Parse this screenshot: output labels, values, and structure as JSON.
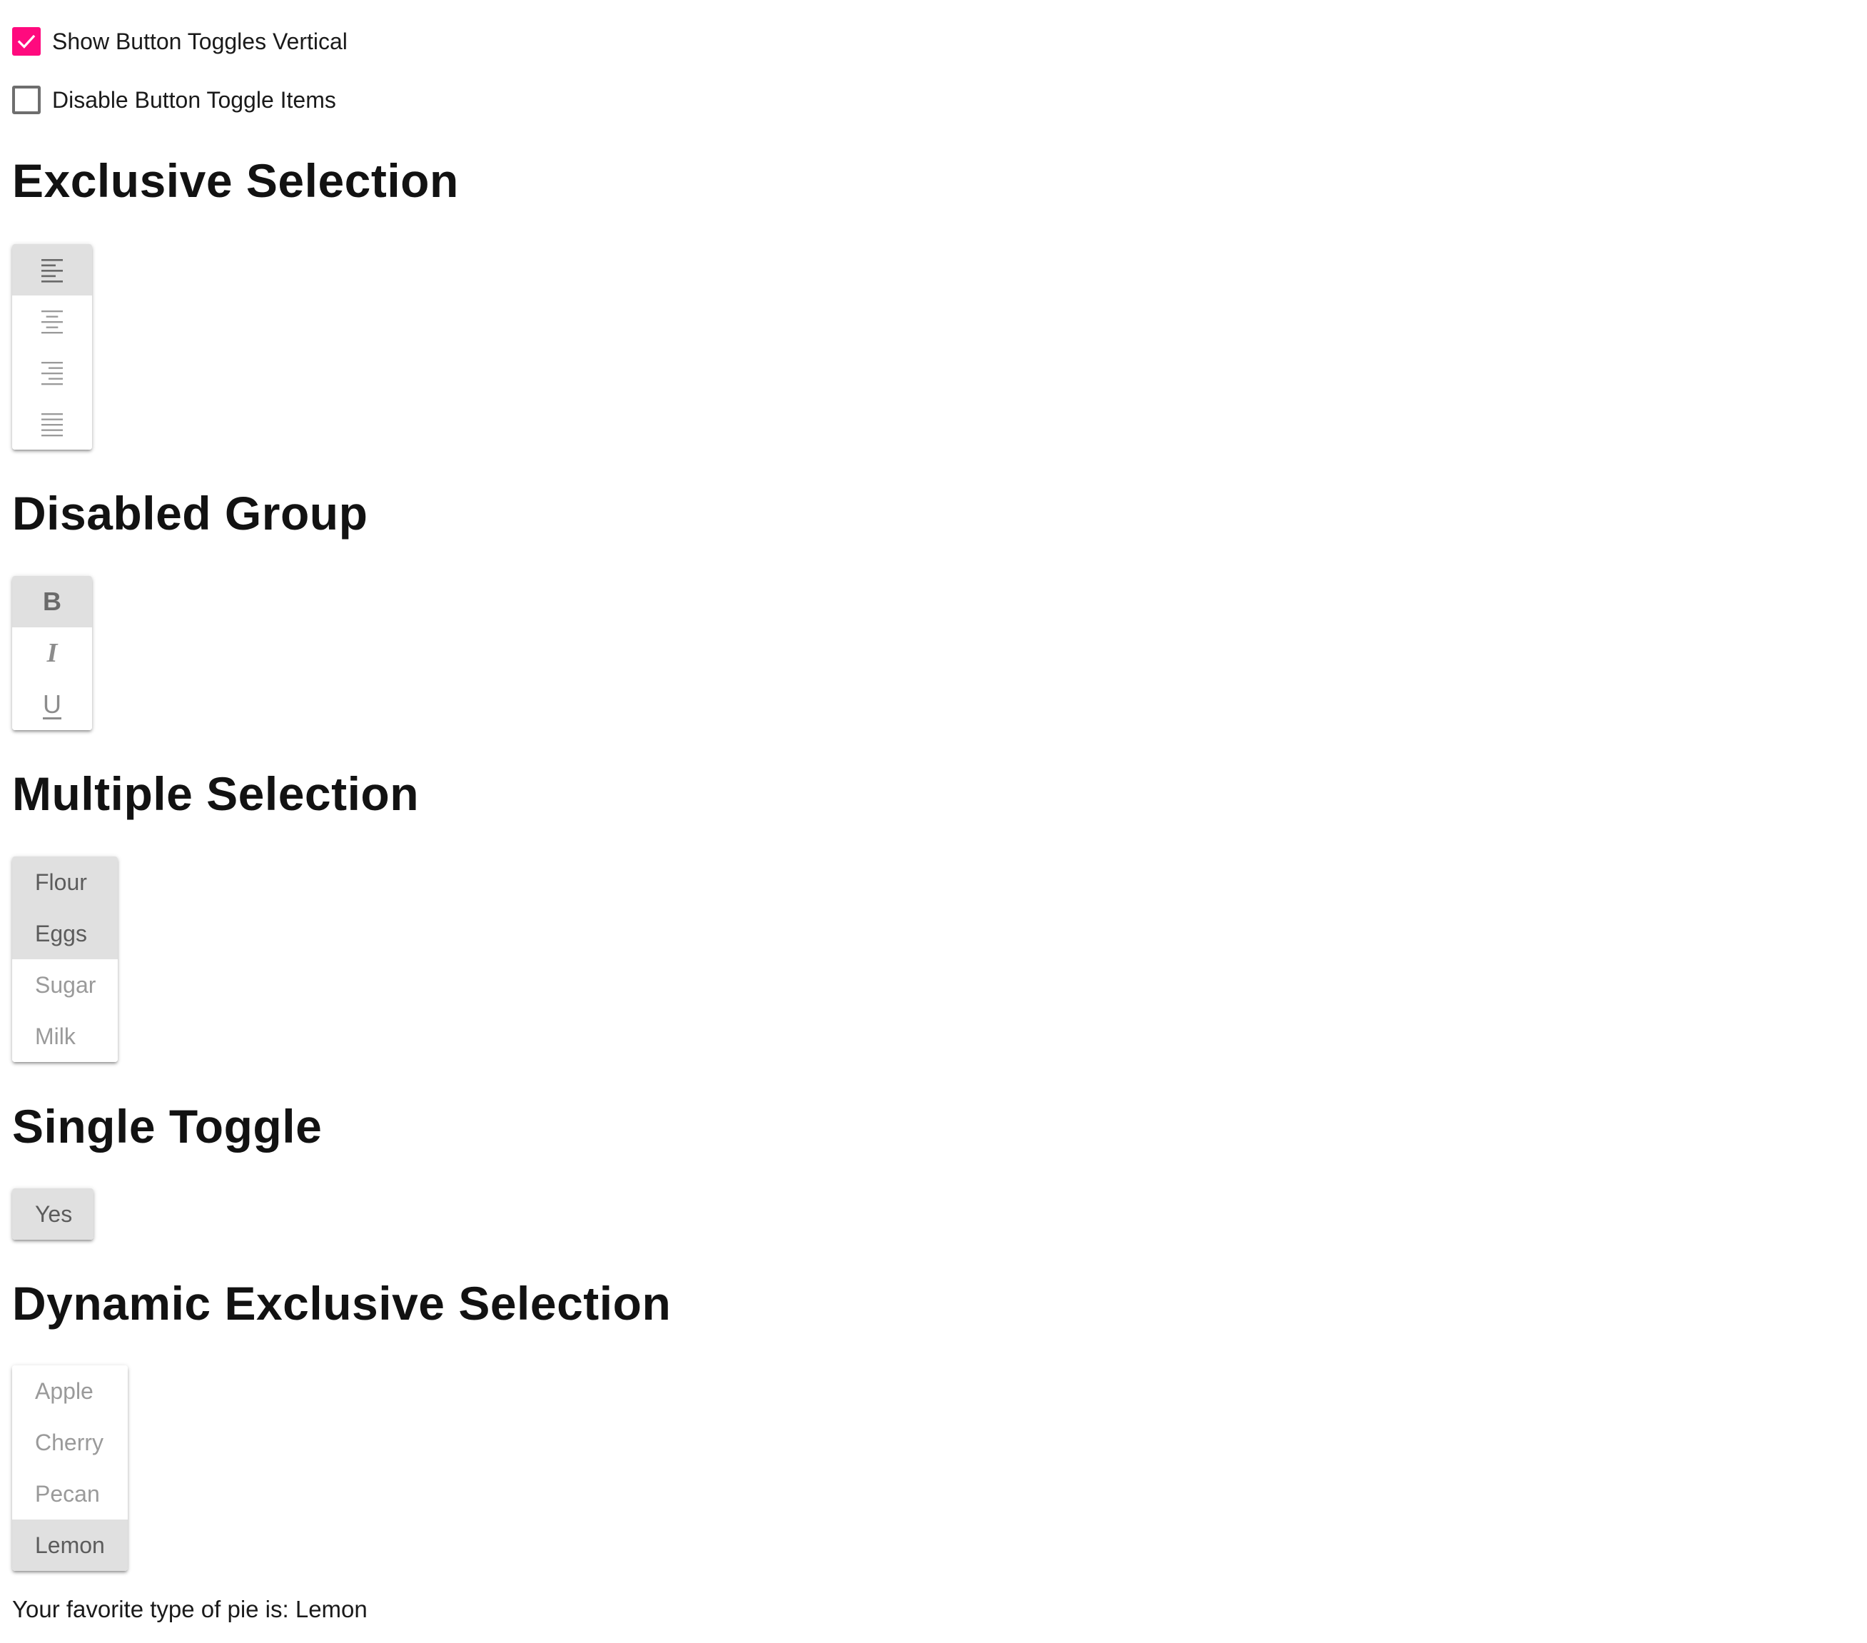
{
  "options": {
    "vertical": {
      "label": "Show Button Toggles Vertical",
      "checked": true
    },
    "disable_items": {
      "label": "Disable Button Toggle Items",
      "checked": false
    }
  },
  "colors": {
    "accent": "#ff0a7e",
    "selected_bg": "#e0e0e0"
  },
  "sections": {
    "exclusive": {
      "title": "Exclusive Selection",
      "items": [
        {
          "icon": "format-align-left-icon",
          "selected": true
        },
        {
          "icon": "format-align-center-icon",
          "selected": false
        },
        {
          "icon": "format-align-right-icon",
          "selected": false
        },
        {
          "icon": "format-align-justify-icon",
          "selected": false
        }
      ]
    },
    "disabled": {
      "title": "Disabled Group",
      "items": [
        {
          "glyph": "B",
          "icon": "format-bold-icon",
          "selected": true
        },
        {
          "glyph": "I",
          "icon": "format-italic-icon",
          "selected": false
        },
        {
          "glyph": "U",
          "icon": "format-underline-icon",
          "selected": false
        }
      ]
    },
    "multiple": {
      "title": "Multiple Selection",
      "items": [
        {
          "label": "Flour",
          "selected": true
        },
        {
          "label": "Eggs",
          "selected": true
        },
        {
          "label": "Sugar",
          "selected": false
        },
        {
          "label": "Milk",
          "selected": false
        }
      ]
    },
    "single": {
      "title": "Single Toggle",
      "items": [
        {
          "label": "Yes",
          "selected": true
        }
      ]
    },
    "dynamic": {
      "title": "Dynamic Exclusive Selection",
      "items": [
        {
          "label": "Apple",
          "selected": false
        },
        {
          "label": "Cherry",
          "selected": false
        },
        {
          "label": "Pecan",
          "selected": false
        },
        {
          "label": "Lemon",
          "selected": true
        }
      ],
      "result_text": "Your favorite type of pie is: Lemon"
    }
  }
}
